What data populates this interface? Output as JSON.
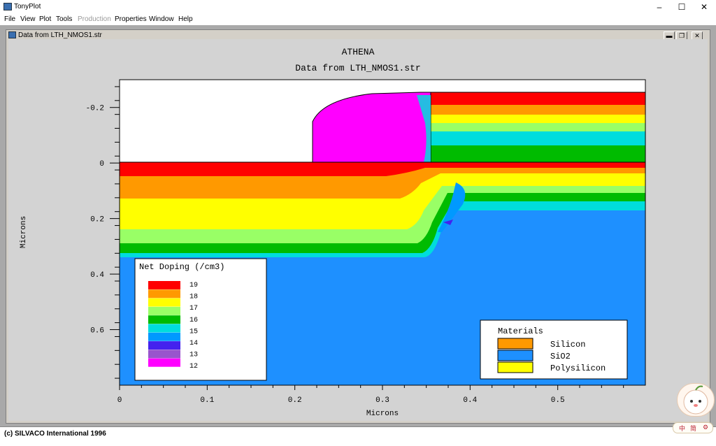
{
  "app": {
    "title": "TonyPlot"
  },
  "window_controls": {
    "minimize": "–",
    "maximize": "☐",
    "close": "✕"
  },
  "menu": {
    "items": [
      "File",
      "View",
      "Plot",
      "Tools",
      "Production",
      "Properties",
      "Window",
      "Help"
    ],
    "disabled": [
      "Production"
    ]
  },
  "child_window": {
    "title": "Data from LTH_NMOS1.str",
    "buttons": [
      "▬",
      "❐",
      "✕"
    ]
  },
  "plot": {
    "title": "ATHENA",
    "subtitle": "Data from LTH_NMOS1.str"
  },
  "legend_doping": {
    "title": "Net Doping (/cm3)",
    "levels": [
      {
        "label": "19",
        "color": "#ff0000"
      },
      {
        "label": "18",
        "color": "#ff9900"
      },
      {
        "label": "17",
        "color": "#ffff00"
      },
      {
        "label": "16",
        "color": "#99ff66"
      },
      {
        "label": "15",
        "color": "#00bb00"
      },
      {
        "label": "14",
        "color": "#00dddd"
      },
      {
        "label": "13",
        "color": "#0099ff"
      },
      {
        "label": "13",
        "color": "#4422ee"
      },
      {
        "label": "12",
        "color": "#9955cc"
      },
      {
        "label": "12",
        "color": "#ff00ff"
      }
    ],
    "printed_labels": [
      "19",
      "18",
      "17",
      "16",
      "15",
      "14",
      "13",
      "12"
    ]
  },
  "legend_materials": {
    "title": "Materials",
    "items": [
      {
        "label": "Silicon",
        "color": "#ff9900"
      },
      {
        "label": "SiO2",
        "color": "#1e90ff"
      },
      {
        "label": "Polysilicon",
        "color": "#ffff00"
      }
    ]
  },
  "status": {
    "text": "(c) SILVACO International 1996"
  },
  "ime": {
    "labels": [
      "中",
      "简"
    ]
  },
  "chart_data": {
    "type": "heatmap",
    "title": "ATHENA",
    "subtitle": "Data from LTH_NMOS1.str",
    "xlabel": "Microns",
    "ylabel": "Microns",
    "xlim": [
      0,
      0.6
    ],
    "ylim": [
      0.8,
      -0.3
    ],
    "y_inverted": true,
    "x_ticks": [
      0,
      0.1,
      0.2,
      0.3,
      0.4,
      0.5
    ],
    "x_tick_labels": [
      "0",
      "0.1",
      "0.2",
      "0.3",
      "0.4",
      "0.5"
    ],
    "y_ticks": [
      -0.2,
      0,
      0.2,
      0.4,
      0.6
    ],
    "y_tick_labels": [
      "-0.2",
      "0",
      "0.2",
      "0.4",
      "0.6"
    ],
    "grid": false,
    "colorbar_label": "Net Doping (/cm3)",
    "colorbar_levels": [
      19,
      18,
      17,
      16,
      15,
      14,
      13,
      12
    ],
    "legend_placement": "bottom-left and bottom-right",
    "regions": [
      {
        "material": "Silicon",
        "x_range": [
          0,
          0.6
        ],
        "y_range": [
          0,
          0.8
        ]
      },
      {
        "material": "Polysilicon",
        "x_range": [
          0.35,
          0.6
        ],
        "y_range": [
          -0.27,
          0
        ]
      },
      {
        "material": "SiO2",
        "x_range": [
          0.22,
          0.35
        ],
        "y_range": [
          -0.26,
          0
        ]
      }
    ]
  }
}
